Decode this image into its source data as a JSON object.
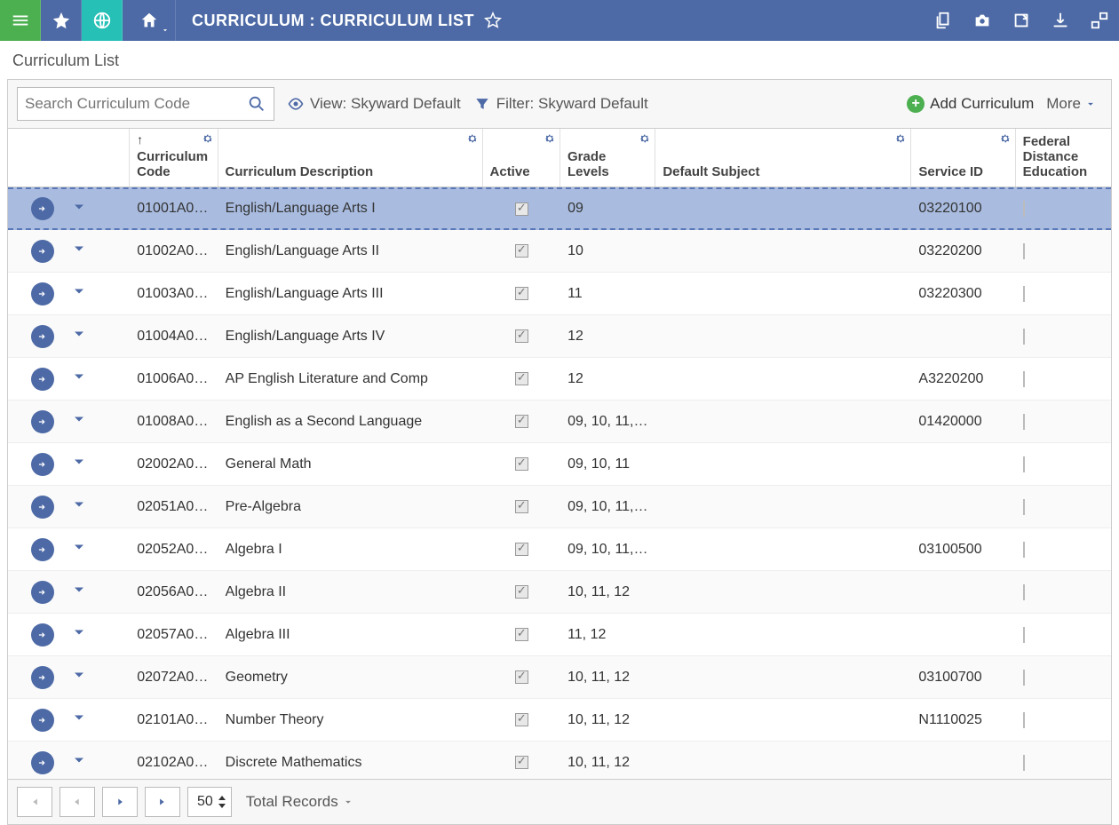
{
  "header": {
    "title": "CURRICULUM : CURRICULUM LIST"
  },
  "breadcrumb": "Curriculum List",
  "toolbar": {
    "search_placeholder": "Search Curriculum Code",
    "view_label": "View: Skyward Default",
    "filter_label": "Filter: Skyward Default",
    "add_label": "Add Curriculum",
    "more_label": "More"
  },
  "columns": {
    "code": "Curriculum Code",
    "desc": "Curriculum Description",
    "active": "Active",
    "grade": "Grade Levels",
    "subject": "Default Subject",
    "service": "Service ID",
    "federal": "Federal Distance Education"
  },
  "rows": [
    {
      "code": "01001A0…",
      "desc": "English/Language Arts I",
      "active": true,
      "grade": "09",
      "subject": "",
      "service": "03220100",
      "selected": true
    },
    {
      "code": "01002A0…",
      "desc": "English/Language Arts II",
      "active": true,
      "grade": "10",
      "subject": "",
      "service": "03220200"
    },
    {
      "code": "01003A0…",
      "desc": "English/Language Arts III",
      "active": true,
      "grade": "11",
      "subject": "",
      "service": "03220300"
    },
    {
      "code": "01004A0…",
      "desc": "English/Language Arts IV",
      "active": true,
      "grade": "12",
      "subject": "",
      "service": ""
    },
    {
      "code": "01006A0…",
      "desc": "AP English Literature and Comp",
      "active": true,
      "grade": "12",
      "subject": "",
      "service": "A3220200"
    },
    {
      "code": "01008A0…",
      "desc": "English as a Second Language",
      "active": true,
      "grade": "09, 10, 11,…",
      "subject": "",
      "service": "01420000"
    },
    {
      "code": "02002A0…",
      "desc": "General Math",
      "active": true,
      "grade": "09, 10, 11",
      "subject": "",
      "service": ""
    },
    {
      "code": "02051A0…",
      "desc": "Pre-Algebra",
      "active": true,
      "grade": "09, 10, 11,…",
      "subject": "",
      "service": ""
    },
    {
      "code": "02052A0…",
      "desc": "Algebra I",
      "active": true,
      "grade": "09, 10, 11,…",
      "subject": "",
      "service": "03100500"
    },
    {
      "code": "02056A0…",
      "desc": "Algebra II",
      "active": true,
      "grade": "10, 11, 12",
      "subject": "",
      "service": ""
    },
    {
      "code": "02057A0…",
      "desc": "Algebra III",
      "active": true,
      "grade": "11, 12",
      "subject": "",
      "service": ""
    },
    {
      "code": "02072A0…",
      "desc": "Geometry",
      "active": true,
      "grade": "10, 11, 12",
      "subject": "",
      "service": "03100700"
    },
    {
      "code": "02101A0…",
      "desc": "Number Theory",
      "active": true,
      "grade": "10, 11, 12",
      "subject": "",
      "service": "N1110025"
    },
    {
      "code": "02102A0…",
      "desc": "Discrete Mathematics",
      "active": true,
      "grade": "10, 11, 12",
      "subject": "",
      "service": ""
    }
  ],
  "footer": {
    "page_size": "50",
    "total_label": "Total Records"
  }
}
